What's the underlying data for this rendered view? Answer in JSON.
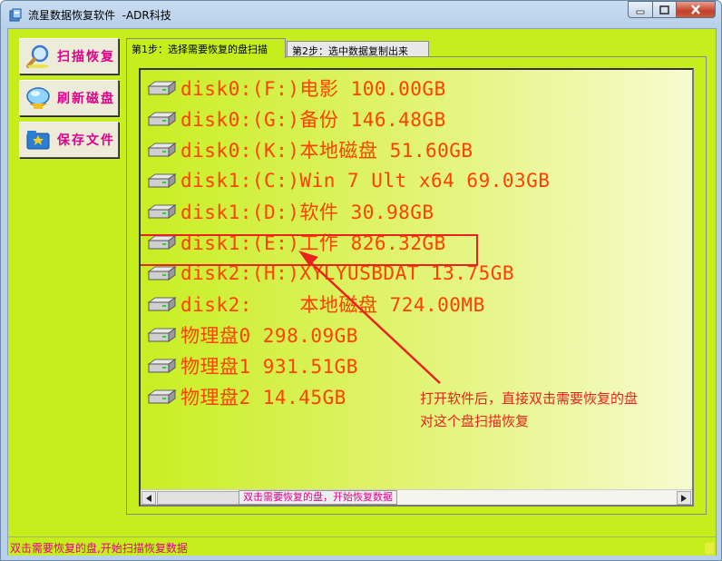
{
  "window": {
    "title": "流星数据恢复软件  -ADR科技"
  },
  "sidebar": {
    "buttons": [
      {
        "label": "扫描恢复",
        "icon": "magnifier-icon"
      },
      {
        "label": "刷新磁盘",
        "icon": "bulb-refresh-icon"
      },
      {
        "label": "保存文件",
        "icon": "save-folder-icon"
      }
    ]
  },
  "tabs": [
    {
      "label": "第1步：选择需要恢复的盘扫描",
      "active": true
    },
    {
      "label": "第2步：选中数据复制出来",
      "active": false
    }
  ],
  "disks": [
    "disk0:(F:)电影 100.00GB",
    "disk0:(G:)备份 146.48GB",
    "disk0:(K:)本地磁盘 51.60GB",
    "disk1:(C:)Win 7 Ult x64 69.03GB",
    "disk1:(D:)软件 30.98GB",
    "disk1:(E:)工作 826.32GB",
    "disk2:(H:)XYLYUSBDAT 13.75GB",
    "disk2:    本地磁盘 724.00MB",
    "物理盘0 298.09GB",
    "物理盘1 931.51GB",
    "物理盘2 14.45GB"
  ],
  "annotation": {
    "line1": "打开软件后，直接双击需要恢复的盘",
    "line2": "对这个盘扫描恢复",
    "color": "#e8221c"
  },
  "list_hint": "双击需要恢复的盘，开始恢复数据",
  "status": {
    "text": "双击需要恢复的盘,开始扫描恢复数据"
  },
  "colors": {
    "background": "#c6ee1c",
    "disk_text": "#ff4000",
    "button_text": "#e0008c"
  }
}
